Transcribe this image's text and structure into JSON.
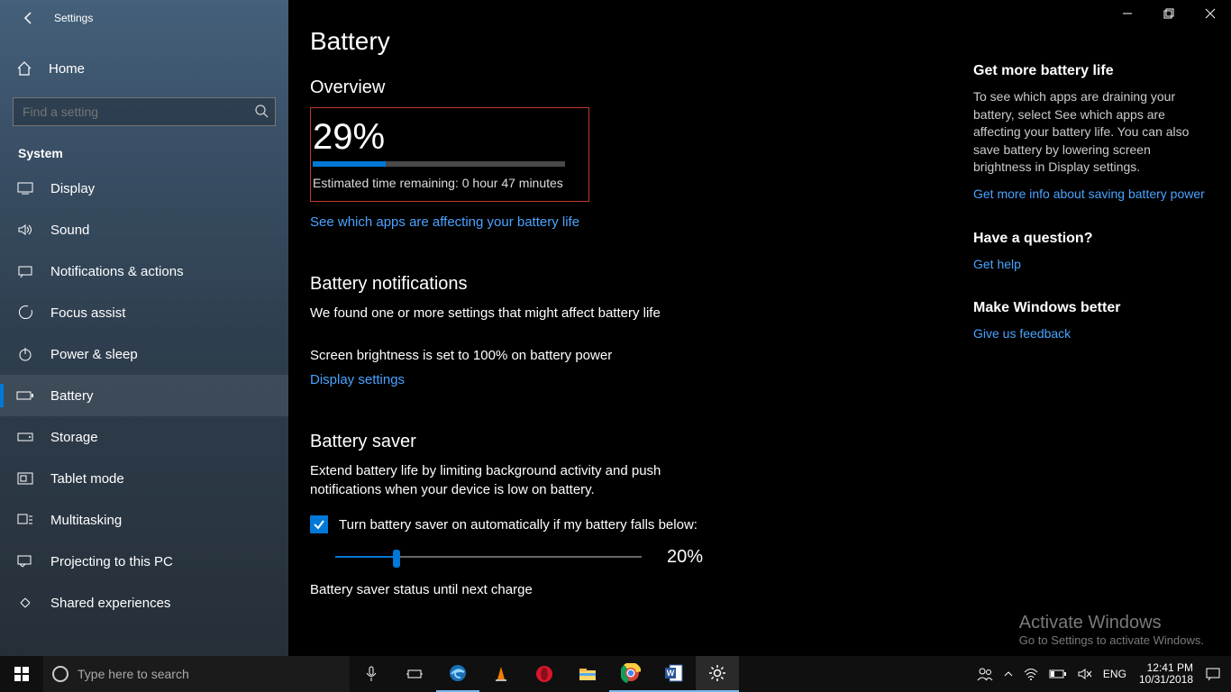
{
  "window": {
    "app_title": "Settings"
  },
  "sidebar": {
    "home_label": "Home",
    "search_placeholder": "Find a setting",
    "group_label": "System",
    "items": [
      {
        "label": "Display"
      },
      {
        "label": "Sound"
      },
      {
        "label": "Notifications & actions"
      },
      {
        "label": "Focus assist"
      },
      {
        "label": "Power & sleep"
      },
      {
        "label": "Battery"
      },
      {
        "label": "Storage"
      },
      {
        "label": "Tablet mode"
      },
      {
        "label": "Multitasking"
      },
      {
        "label": "Projecting to this PC"
      },
      {
        "label": "Shared experiences"
      }
    ],
    "selected_index": 5
  },
  "page": {
    "title": "Battery",
    "overview": {
      "heading": "Overview",
      "percent_text": "29%",
      "percent_value": 29,
      "estimate": "Estimated time remaining: 0 hour 47 minutes",
      "apps_link": "See which apps are affecting your battery life"
    },
    "notifications": {
      "heading": "Battery notifications",
      "found_text": "We found one or more settings that might affect battery life",
      "brightness_text": "Screen brightness is set to 100% on battery power",
      "display_link": "Display settings"
    },
    "saver": {
      "heading": "Battery saver",
      "desc": "Extend battery life by limiting background activity and push notifications when your device is low on battery.",
      "checkbox_label": "Turn battery saver on automatically if my battery falls below:",
      "checkbox_checked": true,
      "slider_value": 20,
      "slider_text": "20%",
      "status_label": "Battery saver status until next charge"
    }
  },
  "right": {
    "more": {
      "heading": "Get more battery life",
      "body": "To see which apps are draining your battery, select See which apps are affecting your battery life. You can also save battery by lowering screen brightness in Display settings.",
      "link": "Get more info about saving battery power"
    },
    "question": {
      "heading": "Have a question?",
      "link": "Get help"
    },
    "better": {
      "heading": "Make Windows better",
      "link": "Give us feedback"
    }
  },
  "activate": {
    "line1": "Activate Windows",
    "line2": "Go to Settings to activate Windows."
  },
  "taskbar": {
    "search_placeholder": "Type here to search",
    "lang": "ENG",
    "time": "12:41 PM",
    "date": "10/31/2018"
  }
}
